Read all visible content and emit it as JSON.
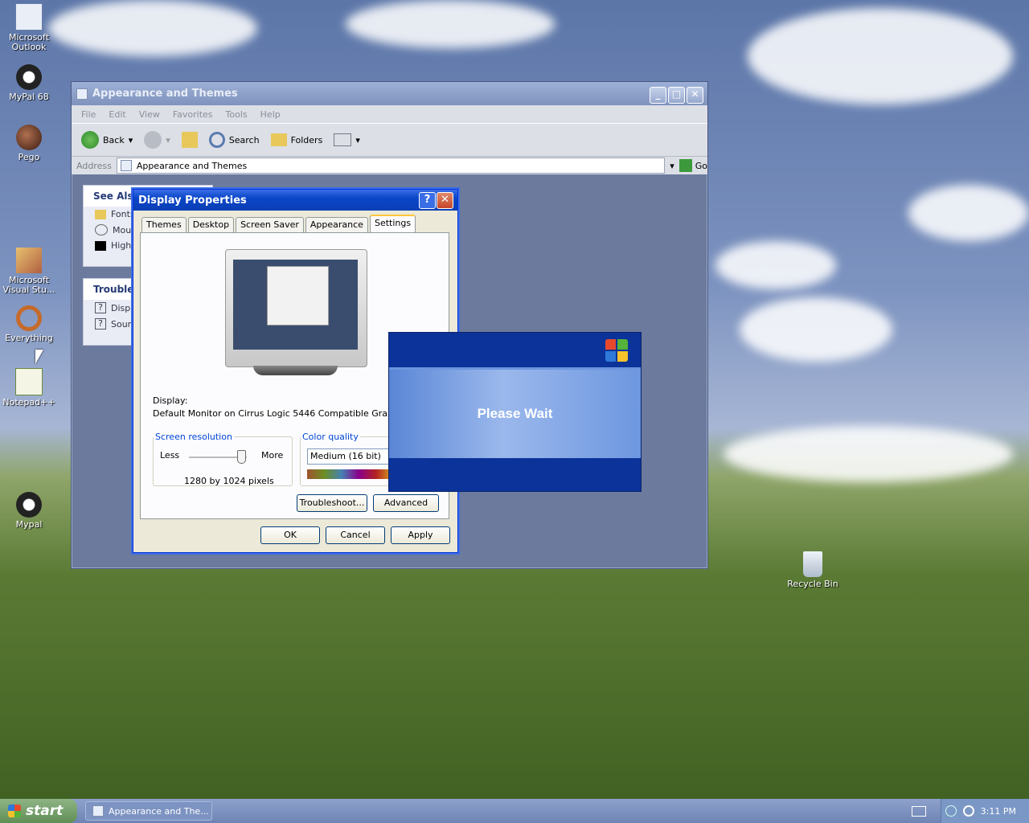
{
  "desktop": {
    "icons": [
      {
        "label": "Microsoft Outlook"
      },
      {
        "label": "MyPal 68"
      },
      {
        "label": "Pego"
      },
      {
        "label": "Microsoft Visual Stu..."
      },
      {
        "label": "Everything"
      },
      {
        "label": "Notepad++"
      },
      {
        "label": "Mypal"
      },
      {
        "label": "Recycle Bin"
      }
    ]
  },
  "explorer": {
    "title": "Appearance and Themes",
    "menu": [
      "File",
      "Edit",
      "View",
      "Favorites",
      "Tools",
      "Help"
    ],
    "toolbar": {
      "back": "Back",
      "search": "Search",
      "folders": "Folders"
    },
    "address": {
      "label": "Address",
      "value": "Appearance and Themes",
      "go": "Go"
    },
    "see_also": {
      "title": "See Also",
      "items": [
        "Fonts",
        "Mouse",
        "High C"
      ]
    },
    "troubleshooters": {
      "title": "Troubles",
      "items": [
        "Displa",
        "Sound"
      ]
    }
  },
  "display_properties": {
    "title": "Display Properties",
    "tabs": [
      "Themes",
      "Desktop",
      "Screen Saver",
      "Appearance",
      "Settings"
    ],
    "active_tab": "Settings",
    "display_label": "Display:",
    "display_value": "Default Monitor on Cirrus Logic 5446 Compatible Graphics Ada",
    "resolution": {
      "legend": "Screen resolution",
      "less": "Less",
      "more": "More",
      "value": "1280 by 1024 pixels"
    },
    "color_quality": {
      "legend": "Color quality",
      "value": "Medium (16 bit)"
    },
    "buttons": {
      "troubleshoot": "Troubleshoot...",
      "advanced": "Advanced",
      "ok": "OK",
      "cancel": "Cancel",
      "apply": "Apply"
    }
  },
  "please_wait": {
    "message": "Please Wait"
  },
  "taskbar": {
    "start": "start",
    "task": "Appearance and The...",
    "clock": "3:11 PM"
  }
}
